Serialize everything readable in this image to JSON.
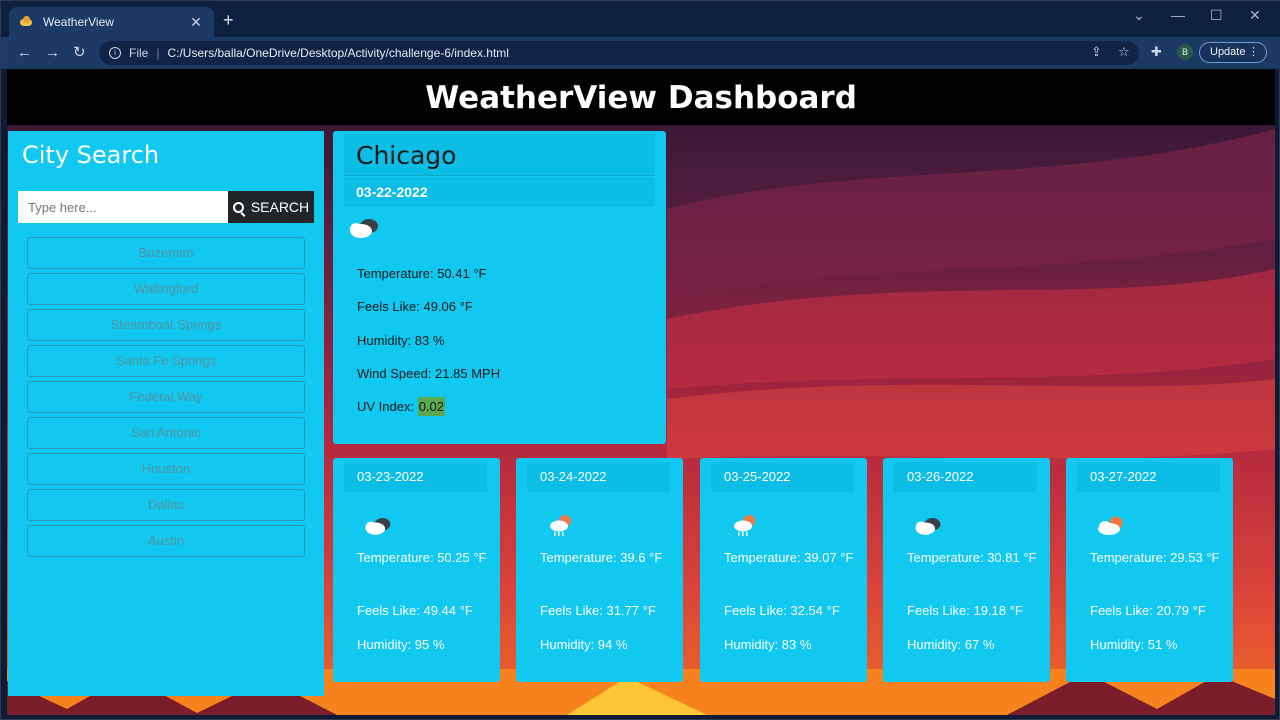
{
  "browser": {
    "tab_title": "WeatherView",
    "url_protocol": "File",
    "url": "C:/Users/balla/OneDrive/Desktop/Activity/challenge-6/index.html",
    "update_label": "Update",
    "avatar_letter": "B"
  },
  "header": {
    "title": "WeatherView Dashboard"
  },
  "search": {
    "title": "City Search",
    "placeholder": "Type here...",
    "button_label": "SEARCH",
    "history": [
      "Bozeman",
      "Wallingford",
      "Steamboat Springs",
      "Santa Fe Springs",
      "Federal Way",
      "San Antonio",
      "Houston",
      "Dallas",
      "Austin"
    ]
  },
  "current": {
    "city": "Chicago",
    "date": "03-22-2022",
    "icon": "cloudy-icon",
    "temperature": "Temperature: 50.41 °F",
    "feels_like": "Feels Like: 49.06 °F",
    "humidity": "Humidity: 83 %",
    "wind": "Wind Speed: 21.85 MPH",
    "uv_label": "UV Index: ",
    "uv_value": "0.02"
  },
  "forecast": [
    {
      "date": "03-23-2022",
      "icon": "cloudy-icon",
      "temperature": "Temperature: 50.25 °F",
      "feels_like": "Feels Like: 49.44 °F",
      "humidity": "Humidity: 95 %"
    },
    {
      "date": "03-24-2022",
      "icon": "sun-cloud-rain-icon",
      "temperature": "Temperature: 39.6 °F",
      "feels_like": "Feels Like: 31.77 °F",
      "humidity": "Humidity: 94 %"
    },
    {
      "date": "03-25-2022",
      "icon": "sun-cloud-rain-icon",
      "temperature": "Temperature: 39.07 °F",
      "feels_like": "Feels Like: 32.54 °F",
      "humidity": "Humidity: 83 %"
    },
    {
      "date": "03-26-2022",
      "icon": "cloudy-icon",
      "temperature": "Temperature: 30.81 °F",
      "feels_like": "Feels Like: 19.18 °F",
      "humidity": "Humidity: 67 %"
    },
    {
      "date": "03-27-2022",
      "icon": "sun-cloud-icon",
      "temperature": "Temperature: 29.53 °F",
      "feels_like": "Feels Like: 20.79 °F",
      "humidity": "Humidity: 51 %"
    }
  ],
  "colors": {
    "panel": "#11c8f0",
    "header": "#000000",
    "uv_badge": "#5aa94f"
  }
}
